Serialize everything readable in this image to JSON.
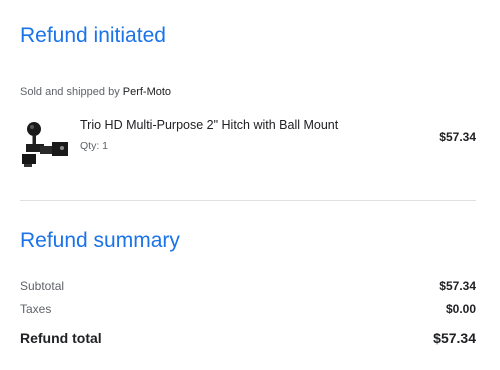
{
  "header": {
    "title": "Refund initiated"
  },
  "order": {
    "seller_prefix": "Sold and shipped by",
    "seller_name": "Perf-Moto",
    "item": {
      "image_icon": "trailer-hitch-ball-mount-image",
      "name": "Trio HD Multi-Purpose 2\" Hitch with Ball Mount",
      "qty": "Qty: 1",
      "price": "$57.34"
    }
  },
  "summary": {
    "title": "Refund summary",
    "subtotal_label": "Subtotal",
    "subtotal_value": "$57.34",
    "taxes_label": "Taxes",
    "taxes_value": "$0.00",
    "total_label": "Refund total",
    "total_value": "$57.34"
  },
  "colors": {
    "accent": "#1a73e8",
    "text": "#202124",
    "muted": "#5f6368",
    "divider": "#e0e0e0"
  }
}
